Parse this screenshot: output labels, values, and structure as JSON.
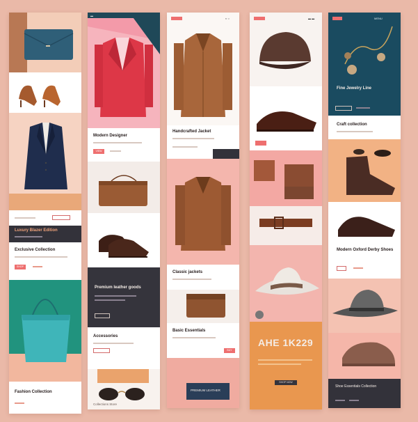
{
  "colors": {
    "background": "#eab9a8",
    "accent": "#ee6f6f",
    "dark_panel": "#35343c",
    "teal": "#1a4b60",
    "orange": "#e99a55"
  },
  "col1": {
    "promo_title": "Luxury Blazer Edition",
    "section_title": "Exclusive Collection",
    "bottom_title": "Fashion Collection",
    "button_label": "SHOP"
  },
  "col2": {
    "hero_caption": "Modern Designer",
    "dark_title": "Premium leather goods",
    "mid_title": "Accessories",
    "bottom_caption": "Collections Store",
    "button_label": "VIEW"
  },
  "col3": {
    "hero_caption": "Handcrafted Jacket",
    "section_title": "Classic jackets",
    "bag_caption": "Basic Essentials",
    "wallet_label": "PREMIUM LEATHER",
    "button_label": "BUY"
  },
  "col4": {
    "price_title": "AHE 1K229",
    "button_label": "SHOP NOW"
  },
  "col5": {
    "hero_title": "Fine Jewelry Line",
    "section_title": "Craft collection",
    "shoes_title": "Modern Oxford Derby Shoes",
    "bottom_title": "Shoe Essentials Collection",
    "nav_label": "MENU"
  }
}
